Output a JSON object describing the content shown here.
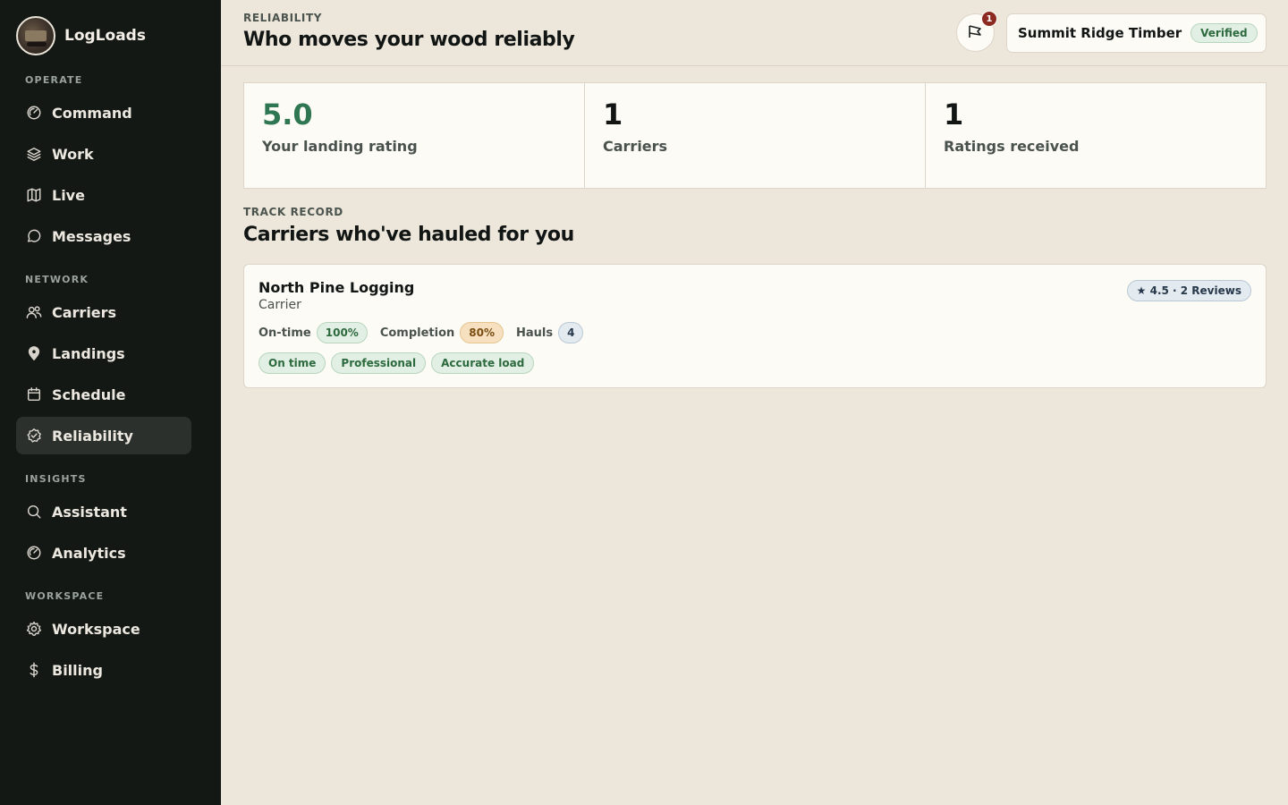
{
  "app": {
    "name": "LogLoads"
  },
  "sidebar": {
    "sections": [
      {
        "label": "OPERATE",
        "items": [
          {
            "label": "Command",
            "icon": "dashboard-icon"
          },
          {
            "label": "Work",
            "icon": "layers-icon"
          },
          {
            "label": "Live",
            "icon": "map-icon"
          },
          {
            "label": "Messages",
            "icon": "chat-icon"
          }
        ]
      },
      {
        "label": "NETWORK",
        "items": [
          {
            "label": "Carriers",
            "icon": "users-icon"
          },
          {
            "label": "Landings",
            "icon": "location-pin-icon"
          },
          {
            "label": "Schedule",
            "icon": "calendar-icon"
          },
          {
            "label": "Reliability",
            "icon": "shield-check-icon",
            "active": true
          }
        ]
      },
      {
        "label": "INSIGHTS",
        "items": [
          {
            "label": "Assistant",
            "icon": "search-icon"
          },
          {
            "label": "Analytics",
            "icon": "dashboard-icon"
          }
        ]
      },
      {
        "label": "WORKSPACE",
        "items": [
          {
            "label": "Workspace",
            "icon": "gear-icon"
          },
          {
            "label": "Billing",
            "icon": "dollar-icon"
          }
        ]
      }
    ]
  },
  "header": {
    "eyebrow": "RELIABILITY",
    "title": "Who moves your wood reliably",
    "notification_count": "1",
    "org_name": "Summit Ridge Timber",
    "org_status": "Verified"
  },
  "stats": [
    {
      "value": "5.0",
      "label": "Your landing rating"
    },
    {
      "value": "1",
      "label": "Carriers"
    },
    {
      "value": "1",
      "label": "Ratings received"
    }
  ],
  "track_record": {
    "eyebrow": "TRACK RECORD",
    "title": "Carriers who've hauled for you",
    "carriers": [
      {
        "name": "North Pine Logging",
        "role": "Carrier",
        "reviews": "★ 4.5 · 2 Reviews",
        "on_time_label": "On-time",
        "on_time_value": "100%",
        "completion_label": "Completion",
        "completion_value": "80%",
        "hauls_label": "Hauls",
        "hauls_value": "4",
        "tags": [
          "On time",
          "Professional",
          "Accurate load"
        ]
      }
    ]
  },
  "colors": {
    "sidebar_bg": "#141815",
    "page_bg": "#ede6da",
    "accent_green": "#2f7652",
    "badge_red": "#8c2a22"
  }
}
